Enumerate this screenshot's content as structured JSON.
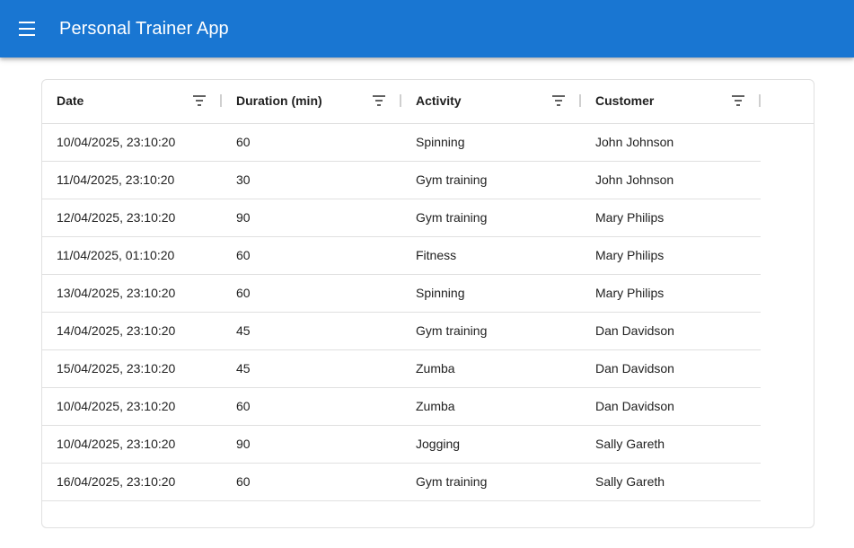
{
  "app": {
    "title": "Personal Trainer App",
    "menu_icon": "hamburger-menu-icon",
    "primary_color": "#1976d2"
  },
  "table": {
    "columns": [
      {
        "label": "Date",
        "icon": "filter-icon"
      },
      {
        "label": "Duration (min)",
        "icon": "filter-icon"
      },
      {
        "label": "Activity",
        "icon": "filter-icon"
      },
      {
        "label": "Customer",
        "icon": "filter-icon"
      }
    ],
    "rows": [
      {
        "date": "10/04/2025, 23:10:20",
        "duration": "60",
        "activity": "Spinning",
        "customer": "John Johnson"
      },
      {
        "date": "11/04/2025, 23:10:20",
        "duration": "30",
        "activity": "Gym training",
        "customer": "John Johnson"
      },
      {
        "date": "12/04/2025, 23:10:20",
        "duration": "90",
        "activity": "Gym training",
        "customer": "Mary Philips"
      },
      {
        "date": "11/04/2025, 01:10:20",
        "duration": "60",
        "activity": "Fitness",
        "customer": "Mary Philips"
      },
      {
        "date": "13/04/2025, 23:10:20",
        "duration": "60",
        "activity": "Spinning",
        "customer": "Mary Philips"
      },
      {
        "date": "14/04/2025, 23:10:20",
        "duration": "45",
        "activity": "Gym training",
        "customer": "Dan Davidson"
      },
      {
        "date": "15/04/2025, 23:10:20",
        "duration": "45",
        "activity": "Zumba",
        "customer": "Dan Davidson"
      },
      {
        "date": "10/04/2025, 23:10:20",
        "duration": "60",
        "activity": "Zumba",
        "customer": "Dan Davidson"
      },
      {
        "date": "10/04/2025, 23:10:20",
        "duration": "90",
        "activity": "Jogging",
        "customer": "Sally Gareth"
      },
      {
        "date": "16/04/2025, 23:10:20",
        "duration": "60",
        "activity": "Gym training",
        "customer": "Sally Gareth"
      }
    ]
  }
}
